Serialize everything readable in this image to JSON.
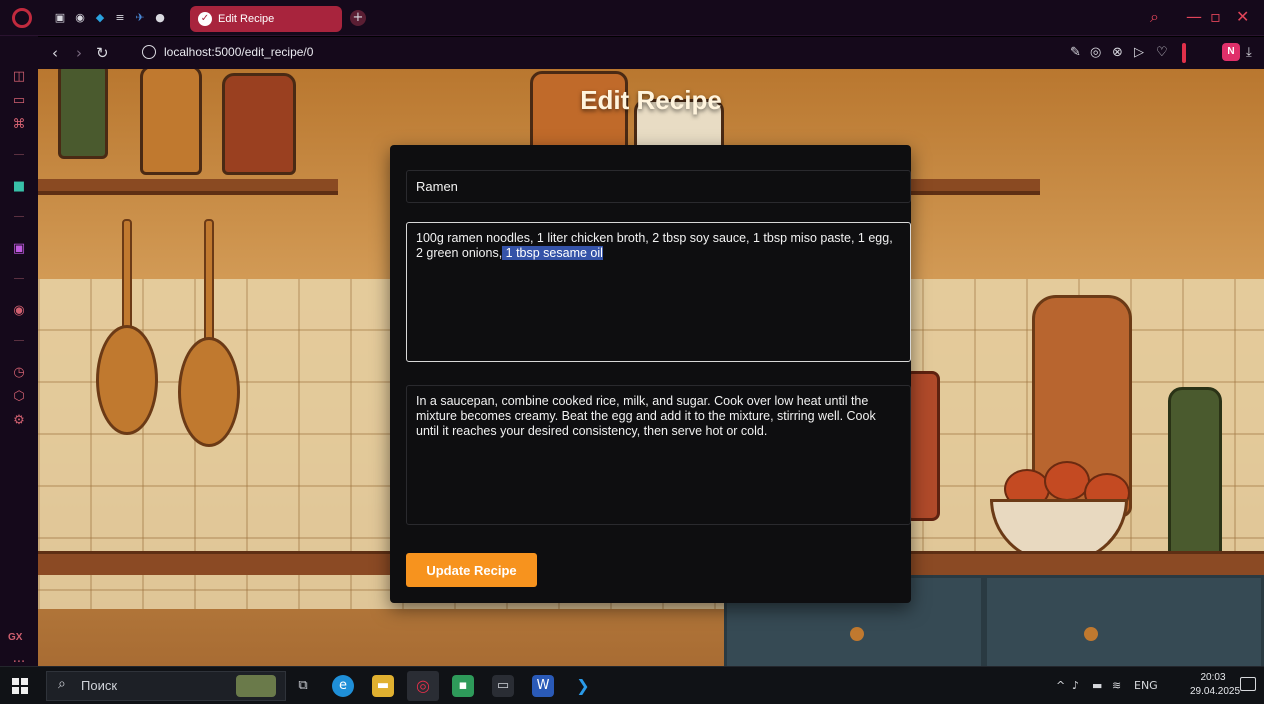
{
  "browser": {
    "tab_title": "Edit Recipe",
    "url": "localhost:5000/edit_recipe/0",
    "profile_initial": "N",
    "new_tab_label": "+",
    "accent": "#a8243d"
  },
  "sidebar": {
    "gx_label": "GX",
    "more_label": "..."
  },
  "page": {
    "title": "Edit Recipe"
  },
  "form": {
    "name_value": "Ramen",
    "ingredients_before_selection": "100g ramen noodles, 1 liter chicken broth, 2 tbsp soy sauce, 1 tbsp miso paste, 1 egg, 2 green onions,",
    "ingredients_selected": " 1 tbsp sesame oil",
    "instructions_value": "In a saucepan, combine cooked rice, milk, and sugar. Cook over low heat until the mixture becomes creamy. Beat the egg and add it to the mixture, stirring well. Cook until it reaches your desired consistency, then serve hot or cold.",
    "submit_label": "Update Recipe",
    "submit_color": "#f7931e"
  },
  "taskbar": {
    "search_placeholder": "Поиск",
    "language": "ENG",
    "time": "20:03",
    "date": "29.04.2025"
  }
}
